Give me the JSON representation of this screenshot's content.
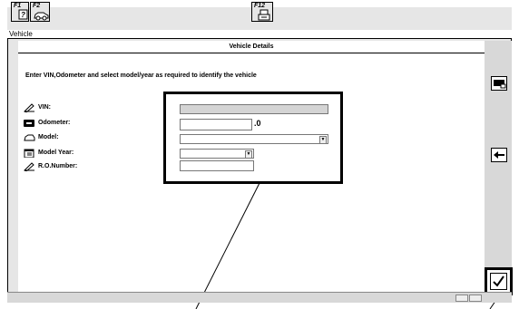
{
  "toolbar": {
    "f1_label": "F1",
    "f2_label": "F2",
    "f12_label": "F12"
  },
  "window_title": "Vehicle",
  "panel": {
    "title": "Vehicle Details",
    "instruction": "Enter VIN,Odometer and select model/year as required to identify the vehicle"
  },
  "fields": {
    "vin_label": "VIN:",
    "odometer_label": "Odometer:",
    "odometer_suffix": ".0",
    "model_label": "Model:",
    "model_year_label": "Model Year:",
    "ro_number_label": "R.O.Number:"
  },
  "icons": {
    "vin": "pen-icon",
    "odometer": "odometer-icon",
    "model": "car-icon",
    "model_year": "calendar-icon",
    "ro_number": "pen-icon",
    "right_top": "screen-icon",
    "right_mid": "back-arrow-icon",
    "ok": "checkmark-icon"
  }
}
